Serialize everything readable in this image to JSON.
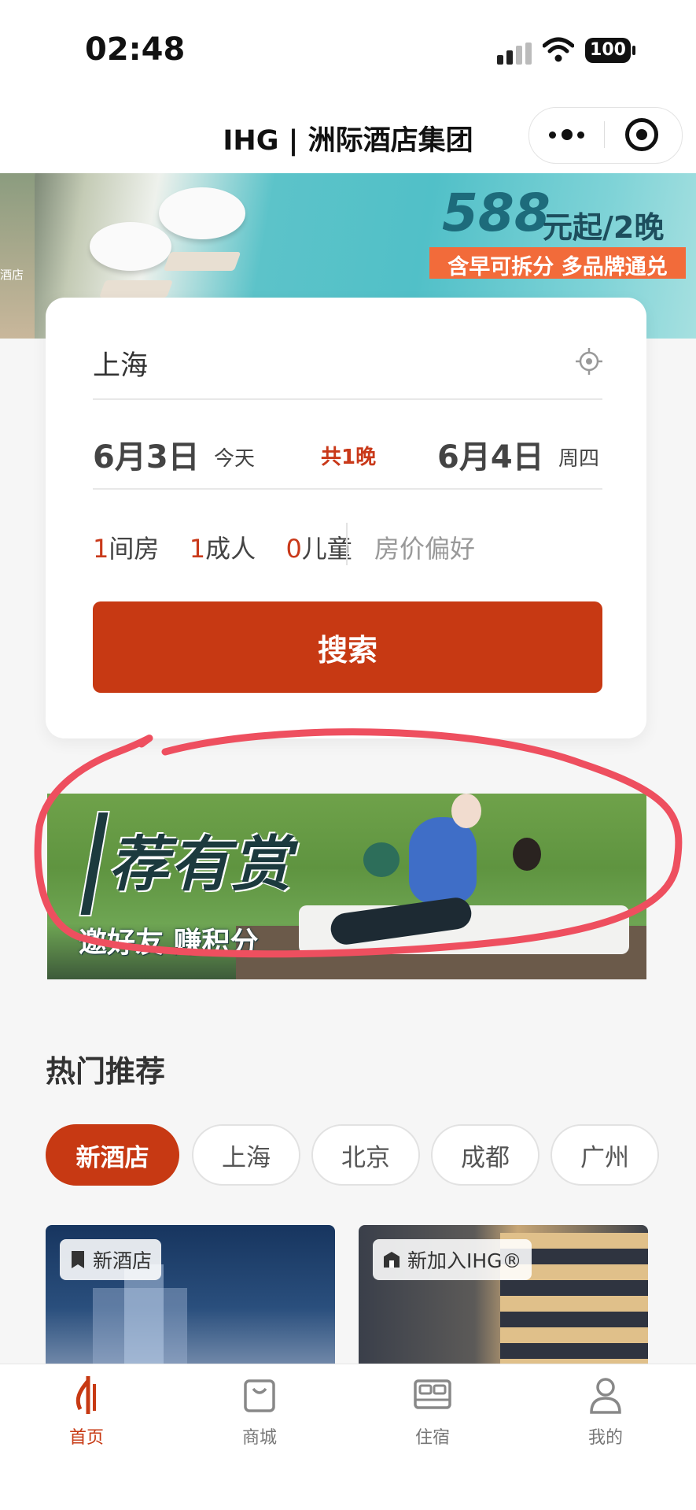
{
  "status_bar": {
    "time": "02:48",
    "battery": "100"
  },
  "nav": {
    "title": "IHG | 洲际酒店集团"
  },
  "hero": {
    "left_text": "酒店",
    "price": "588",
    "price_suffix": "元起/2晚",
    "strip_text": "含早可拆分 多品牌通兑"
  },
  "search": {
    "city": "上海",
    "checkin_date": "6月3日",
    "checkin_label": "今天",
    "nights": "共1晚",
    "checkout_date": "6月4日",
    "checkout_label": "周四",
    "rooms_num": "1",
    "rooms_unit": "间房",
    "adults_num": "1",
    "adults_unit": "成人",
    "children_num": "0",
    "children_unit": "儿童",
    "price_pref": "房价偏好",
    "button": "搜索"
  },
  "promo": {
    "title": "荐有赏",
    "subtitle": "邀好友 赚积分"
  },
  "hot": {
    "title": "热门推荐",
    "chips": [
      "新酒店",
      "上海",
      "北京",
      "成都",
      "广州"
    ],
    "active_chip": 0,
    "cards": [
      {
        "tag": "新酒店",
        "icon": "book-icon"
      },
      {
        "tag": "新加入IHG®",
        "icon": "building-icon"
      }
    ]
  },
  "tabbar": {
    "items": [
      {
        "label": "首页",
        "icon": "ihg-logo-icon",
        "active": true
      },
      {
        "label": "商城",
        "icon": "shopping-bag-icon",
        "active": false
      },
      {
        "label": "住宿",
        "icon": "bed-icon",
        "active": false
      },
      {
        "label": "我的",
        "icon": "person-icon",
        "active": false
      }
    ]
  },
  "colors": {
    "brand": "#c73913",
    "annotation": "#ee4f5f"
  }
}
